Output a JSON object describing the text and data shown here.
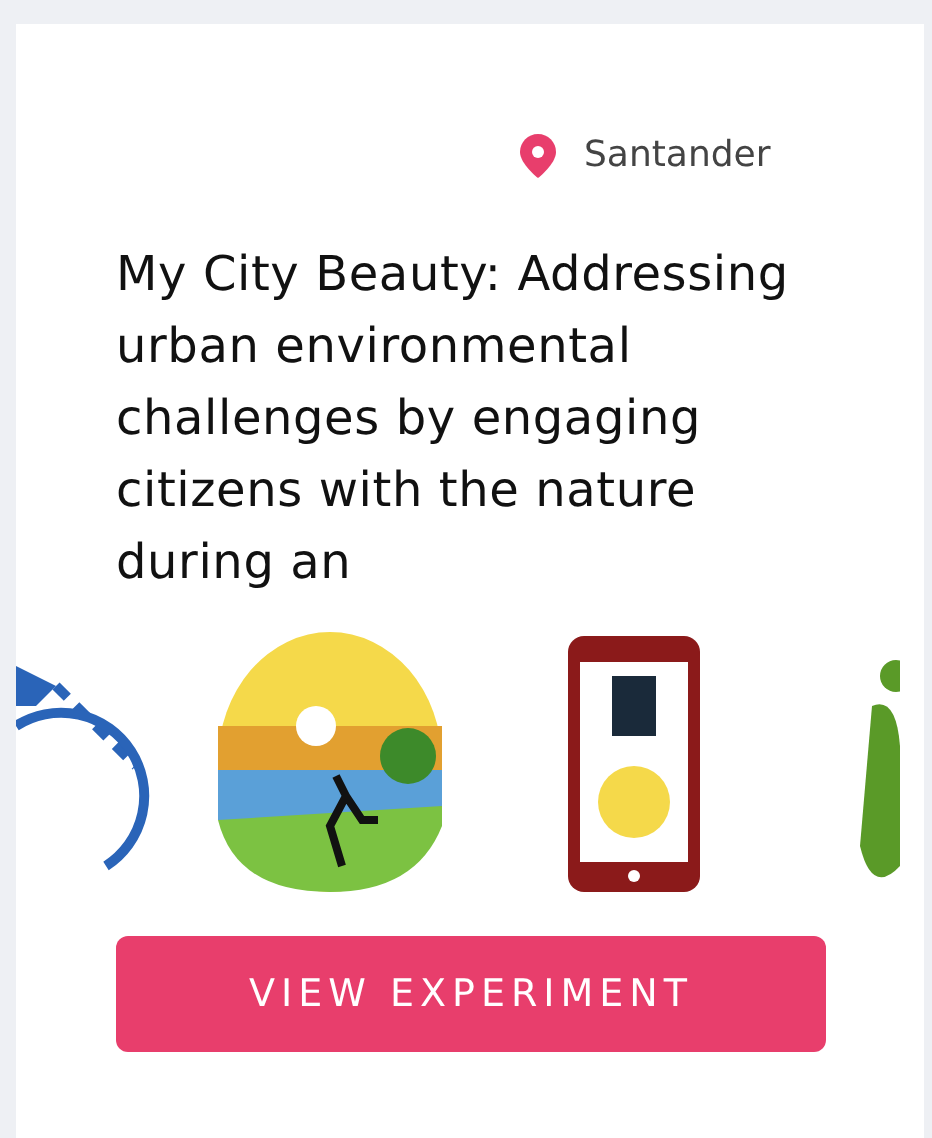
{
  "card": {
    "location": "Santander",
    "title": "My City Beauty: Addressing urban environmental challenges by engaging citizens with the nature during an",
    "button": "VIEW EXPERIMENT"
  }
}
